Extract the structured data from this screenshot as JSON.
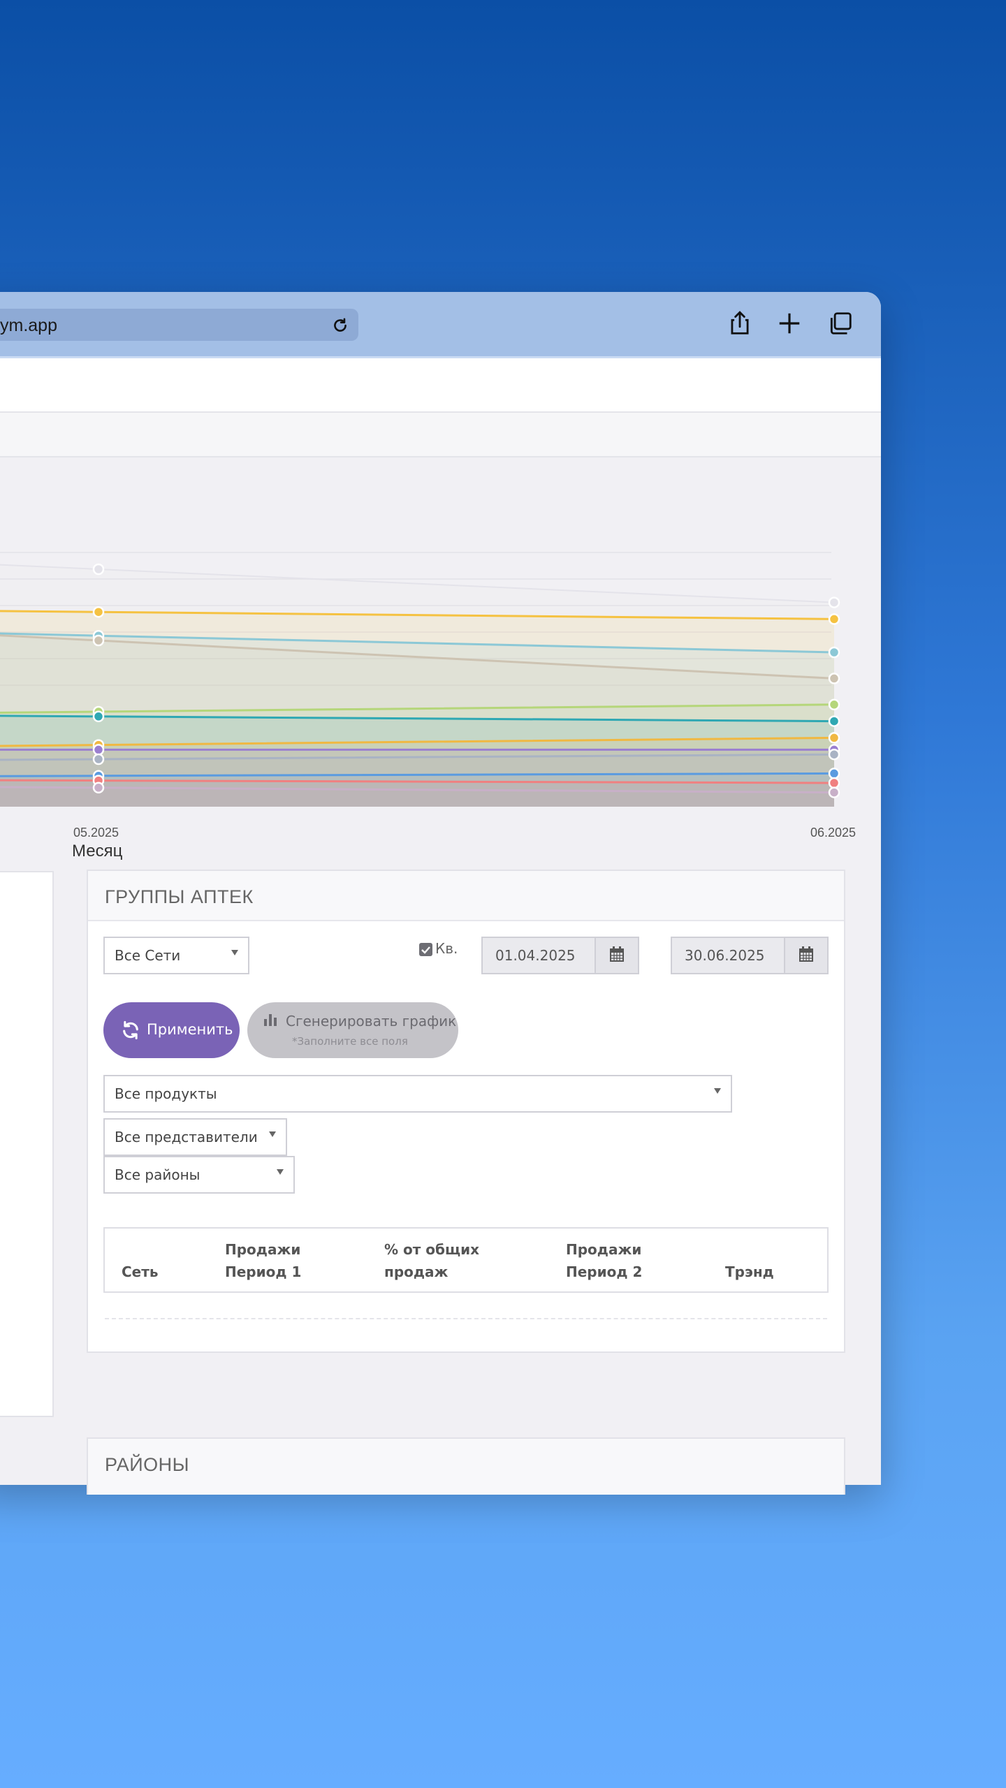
{
  "browser": {
    "url": "ym.app",
    "icons": [
      "reload-icon",
      "share-icon",
      "new-tab-icon",
      "tabs-icon"
    ]
  },
  "chart_data": {
    "type": "area",
    "xlabel": "Месяц",
    "x": [
      "05.2025",
      "06.2025"
    ],
    "series": [
      {
        "values": [
          100,
          86
        ],
        "color": "#e4e3ea"
      },
      {
        "values": [
          82,
          79
        ],
        "color": "#f5c242"
      },
      {
        "values": [
          72,
          65
        ],
        "color": "#8cc8d6"
      },
      {
        "values": [
          70,
          54
        ],
        "color": "#cdc3b2"
      },
      {
        "values": [
          40,
          43
        ],
        "color": "#b5d67a"
      },
      {
        "values": [
          38,
          36
        ],
        "color": "#2fa8b3"
      },
      {
        "values": [
          26,
          29
        ],
        "color": "#f0b842"
      },
      {
        "values": [
          24,
          24
        ],
        "color": "#9a7fd0"
      },
      {
        "values": [
          20,
          22
        ],
        "color": "#a9b3c4"
      },
      {
        "values": [
          13,
          14
        ],
        "color": "#5a9be0"
      },
      {
        "values": [
          11,
          10
        ],
        "color": "#f08080"
      },
      {
        "values": [
          8,
          6
        ],
        "color": "#c8b0c8"
      }
    ],
    "ylim": [
      0,
      110
    ]
  },
  "panel": {
    "title": "ГРУППЫ АПТЕК",
    "network_select": "Все Сети",
    "quarter_label": "Кв.",
    "quarter_checked": true,
    "date_from": "01.04.2025",
    "date_to": "30.06.2025",
    "apply_label": "Применить",
    "generate_label": "Сгенерировать график",
    "generate_hint": "*Заполните все поля",
    "products_select": "Все продукты",
    "reps_select": "Все представители",
    "districts_select": "Все районы",
    "table_headers": {
      "network": "Сеть",
      "sales1_line1": "Продажи",
      "sales1_line2": "Период 1",
      "share_line1": "% от общих",
      "share_line2": "продаж",
      "sales2_line1": "Продажи",
      "sales2_line2": "Период 2",
      "trend": "Трэнд"
    }
  },
  "panel2": {
    "title": "РАЙОНЫ"
  }
}
